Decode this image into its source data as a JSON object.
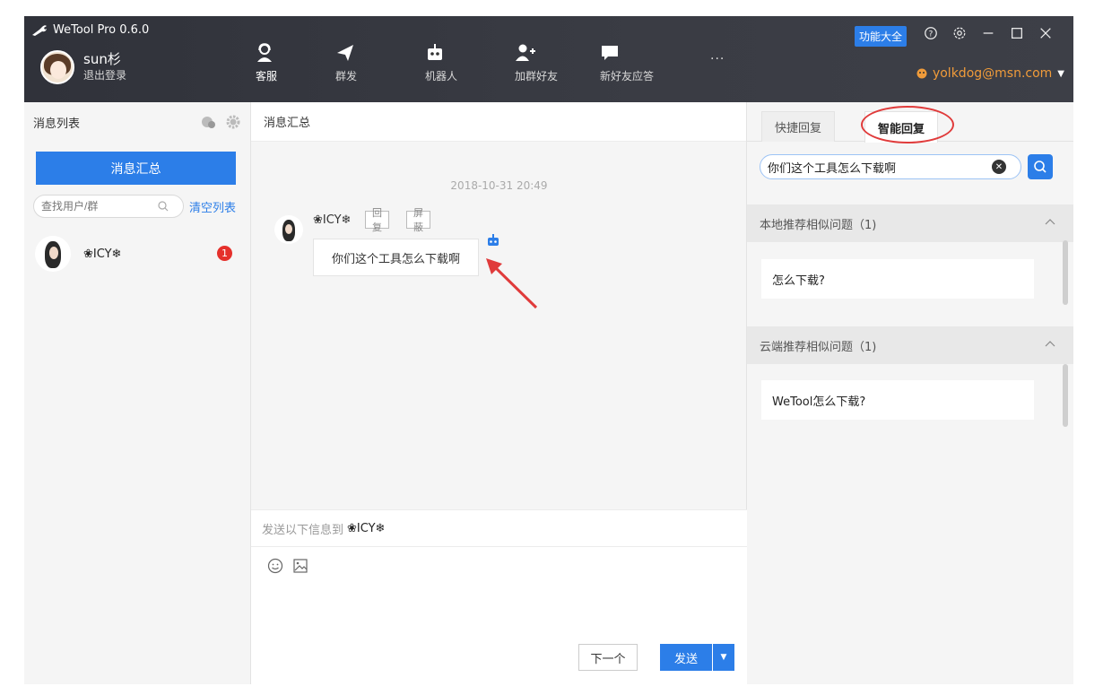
{
  "app": {
    "title": "WeTool Pro 0.6.0",
    "user_name": "sun杉",
    "logout_label": "退出登录",
    "function_button": "功能大全",
    "account_email": "yolkdog@msn.com",
    "more_label": "..."
  },
  "nav": [
    {
      "label": "客服",
      "icon": "customer-service-icon",
      "active": true
    },
    {
      "label": "群发",
      "icon": "send-plane-icon",
      "active": false
    },
    {
      "label": "机器人",
      "icon": "robot-icon",
      "active": false
    },
    {
      "label": "加群好友",
      "icon": "add-friend-icon",
      "active": false
    },
    {
      "label": "新好友应答",
      "icon": "chat-bubble-icon",
      "active": false
    }
  ],
  "left": {
    "title": "消息列表",
    "summary_button": "消息汇总",
    "search_placeholder": "查找用户/群",
    "clear_link": "清空列表",
    "contacts": [
      {
        "name": "❀ICY❄",
        "unread": "1"
      }
    ]
  },
  "middle": {
    "title": "消息汇总",
    "timestamp": "2018-10-31 20:49",
    "message": {
      "sender": "❀ICY❄",
      "reply_tag": "回复",
      "block_tag": "屏蔽",
      "text": "你们这个工具怎么下载啊"
    },
    "compose_prefix": "发送以下信息到",
    "compose_to": "❀ICY❄",
    "next_button": "下一个",
    "send_button": "发送"
  },
  "right": {
    "tabs": [
      "快捷回复",
      "智能回复"
    ],
    "search_value": "你们这个工具怎么下载啊",
    "local_section": "本地推荐相似问题（1)",
    "local_items": [
      "怎么下载?"
    ],
    "cloud_section": "云端推荐相似问题（1)",
    "cloud_items": [
      "WeTool怎么下载?"
    ]
  },
  "colors": {
    "accent": "#2c7ee8",
    "titlebar": "#30323a",
    "badge": "#e5302b",
    "annotation": "#e03b3b",
    "account": "#f09b3a"
  }
}
